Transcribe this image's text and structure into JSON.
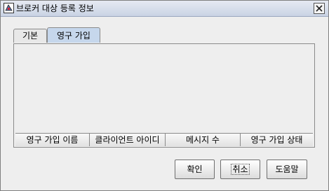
{
  "window": {
    "title": "브로커 대상 등록 정보",
    "icon": "app-icon",
    "close_icon": "close-icon"
  },
  "tabs": [
    {
      "label": "기본",
      "selected": false
    },
    {
      "label": "영구 가입",
      "selected": true
    }
  ],
  "table": {
    "columns": [
      "영구 가입 이름",
      "클라이언트 아이디",
      "메시지 수",
      "영구 가입 상태"
    ],
    "rows": []
  },
  "buttons": {
    "ok": "확인",
    "cancel": "취소",
    "help": "도움말"
  }
}
